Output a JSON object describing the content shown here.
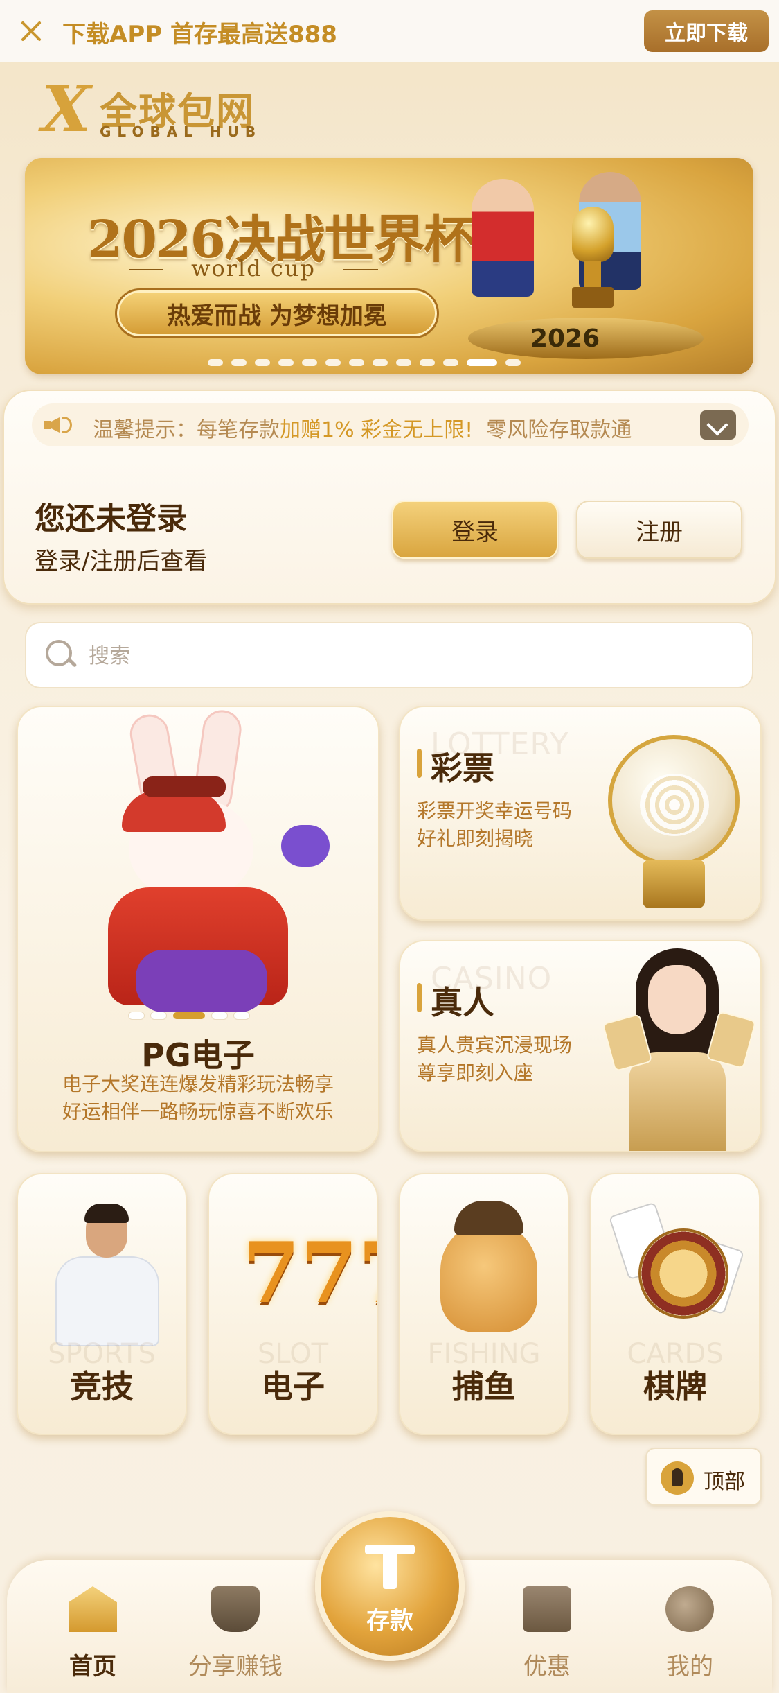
{
  "top_bar": {
    "promo": "下载APP 首存最高送888",
    "download_button": "立即下载"
  },
  "logo": {
    "cn": "全球包网",
    "en": "GLOBAL HUB"
  },
  "banner": {
    "title": "2026决战世界杯",
    "subtitle": "world cup",
    "ribbon": "热爱而战 为梦想加冕",
    "badge": "2026"
  },
  "notice": {
    "prefix": "温馨提示：每笔存款",
    "highlight": "加赠1% 彩金无上限!",
    "suffix": "零风险存取款通"
  },
  "login": {
    "title": "您还未登录",
    "subtitle": "登录/注册后查看",
    "login_button": "登录",
    "register_button": "注册"
  },
  "search": {
    "placeholder": "搜索"
  },
  "games": {
    "pg": {
      "title": "PG电子",
      "desc_line1": "电子大奖连连爆发精彩玩法畅享",
      "desc_line2": "好运相伴一路畅玩惊喜不断欢乐"
    },
    "lottery": {
      "en": "LOTTERY",
      "title": "彩票",
      "desc": "彩票开奖幸运号码好礼即刻揭晓"
    },
    "casino": {
      "en": "CASINO",
      "title": "真人",
      "desc": "真人贵宾沉浸现场尊享即刻入座"
    },
    "small": [
      {
        "en": "SPORTS",
        "label": "竞技"
      },
      {
        "en": "SLOT",
        "label": "电子"
      },
      {
        "en": "FISHING",
        "label": "捕鱼"
      },
      {
        "en": "CARDS",
        "label": "棋牌"
      }
    ]
  },
  "to_top": {
    "label": "顶部"
  },
  "nav": {
    "home": "首页",
    "share": "分享赚钱",
    "deposit": "存款",
    "promo": "优惠",
    "mine": "我的"
  },
  "colors": {
    "accent": "#d9a33b",
    "text_dark": "#4a2a0a",
    "text_gold": "#b4772a"
  }
}
